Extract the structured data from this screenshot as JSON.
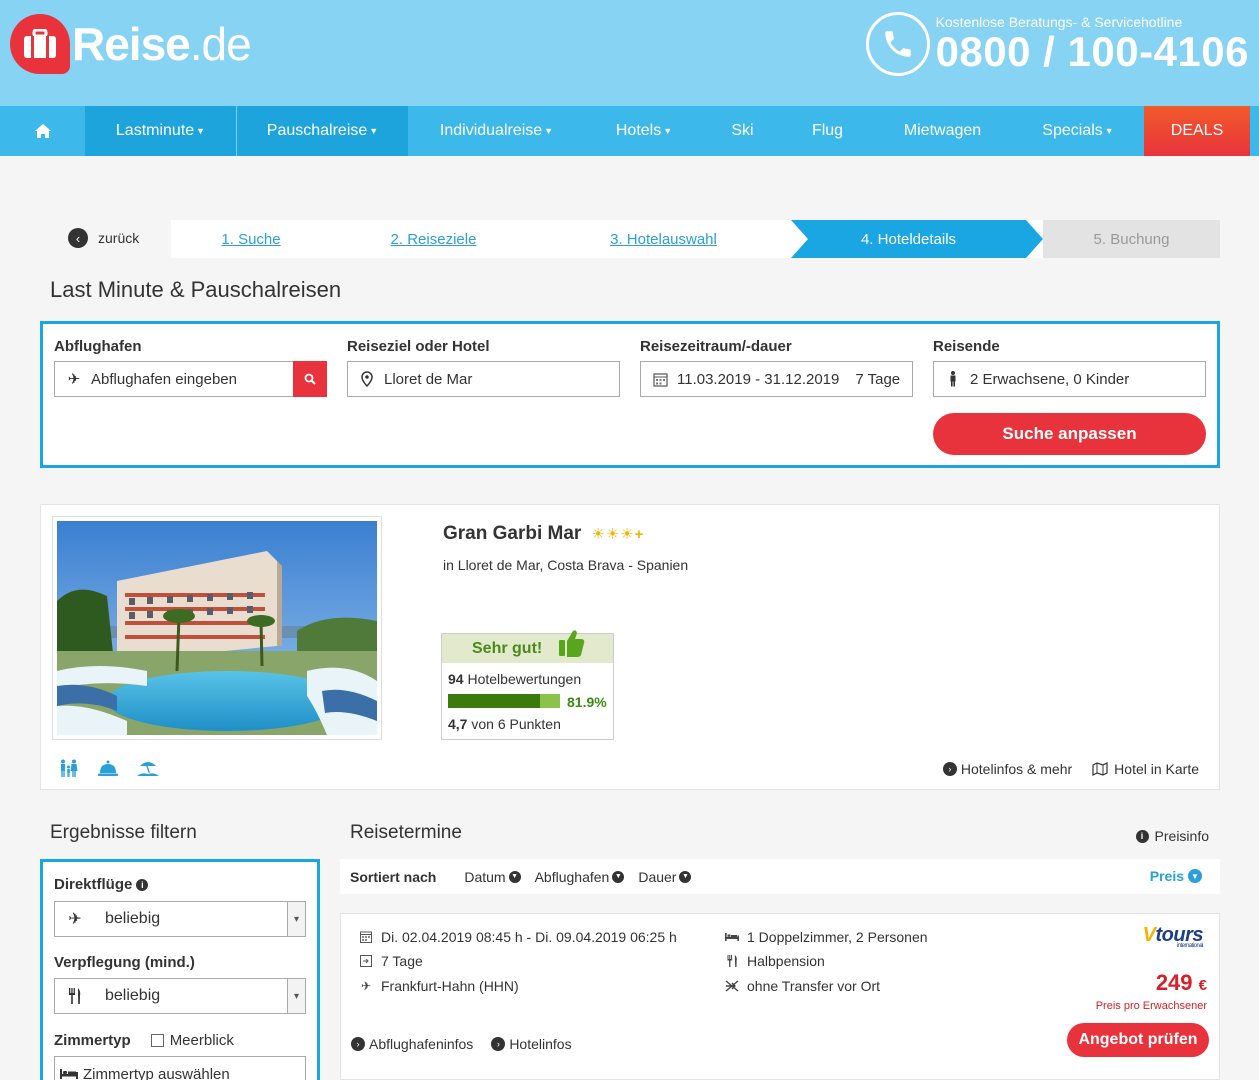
{
  "brand": {
    "name_main": "Reise",
    "name_tld": ".de"
  },
  "hotline": {
    "caption": "Kostenlose Beratungs- & Servicehotline",
    "number": "0800 / 100-4106"
  },
  "nav": {
    "items": [
      {
        "label": "Lastminute",
        "has_caret": true
      },
      {
        "label": "Pauschalreise",
        "has_caret": true
      },
      {
        "label": "Individualreise",
        "has_caret": true
      },
      {
        "label": "Hotels",
        "has_caret": true
      },
      {
        "label": "Ski",
        "has_caret": false
      },
      {
        "label": "Flug",
        "has_caret": false
      },
      {
        "label": "Mietwagen",
        "has_caret": false
      },
      {
        "label": "Specials",
        "has_caret": true
      },
      {
        "label": "DEALS",
        "has_caret": false
      }
    ]
  },
  "steps": {
    "back": "zurück",
    "s1": "1. Suche",
    "s2": "2. Reiseziele",
    "s3": "3. Hotelauswahl",
    "s4": "4. Hoteldetails",
    "s5": "5. Buchung"
  },
  "page_title": "Last Minute & Pauschalreisen",
  "search": {
    "departure_label": "Abflughafen",
    "departure_placeholder": "Abflughafen eingeben",
    "destination_label": "Reiseziel oder Hotel",
    "destination_value": "Lloret de Mar",
    "period_label": "Reisezeitraum/-dauer",
    "period_value": "11.03.2019 - 31.12.2019",
    "duration_value": "7 Tage",
    "travellers_label": "Reisende",
    "travellers_value": "2 Erwachsene, 0 Kinder",
    "submit": "Suche anpassen"
  },
  "hotel": {
    "name": "Gran Garbi Mar",
    "stars": "☀☀☀+",
    "location": "in Lloret de Mar, Costa Brava - Spanien",
    "rating": {
      "verdict": "Sehr gut!",
      "count": "94",
      "count_label": "Hotelbewertungen",
      "recommend_pct": "81.9%",
      "recommend_fraction": 0.819,
      "points": "4,7",
      "points_label": "von 6 Punkten"
    },
    "links": {
      "info": "Hotelinfos & mehr",
      "map": "Hotel in Karte"
    },
    "amenity_icons": [
      "family-icon",
      "room-service-icon",
      "beach-icon"
    ]
  },
  "filter": {
    "title": "Ergebnisse filtern",
    "direct_label": "Direktflüge",
    "direct_value": "beliebig",
    "board_label": "Verpflegung (mind.)",
    "board_value": "beliebig",
    "room_label": "Zimmertyp",
    "seaview_label": "Meerblick",
    "room_placeholder": "Zimmertyp auswählen"
  },
  "results": {
    "title": "Reisetermine",
    "preisinfo": "Preisinfo",
    "sort_label": "Sortiert nach",
    "sort_date": "Datum",
    "sort_airport": "Abflughafen",
    "sort_duration": "Dauer",
    "sort_price": "Preis"
  },
  "offer": {
    "dates": "Di. 02.04.2019 08:45 h - Di. 09.04.2019 06:25 h",
    "duration": "7 Tage",
    "airport": "Frankfurt-Hahn (HHN)",
    "room": "1 Doppelzimmer, 2 Personen",
    "board": "Halbpension",
    "transfer": "ohne Transfer vor Ort",
    "operator": "tours",
    "operator_sub": "international",
    "price": "249",
    "currency": "€",
    "price_note": "Preis pro Erwachsener",
    "button": "Angebot prüfen",
    "link_airport": "Abflughafeninfos",
    "link_hotel": "Hotelinfos"
  },
  "colors": {
    "accent_blue": "#3db8ea",
    "brand_red": "#e8333c",
    "rating_green": "#3d7a0e"
  }
}
